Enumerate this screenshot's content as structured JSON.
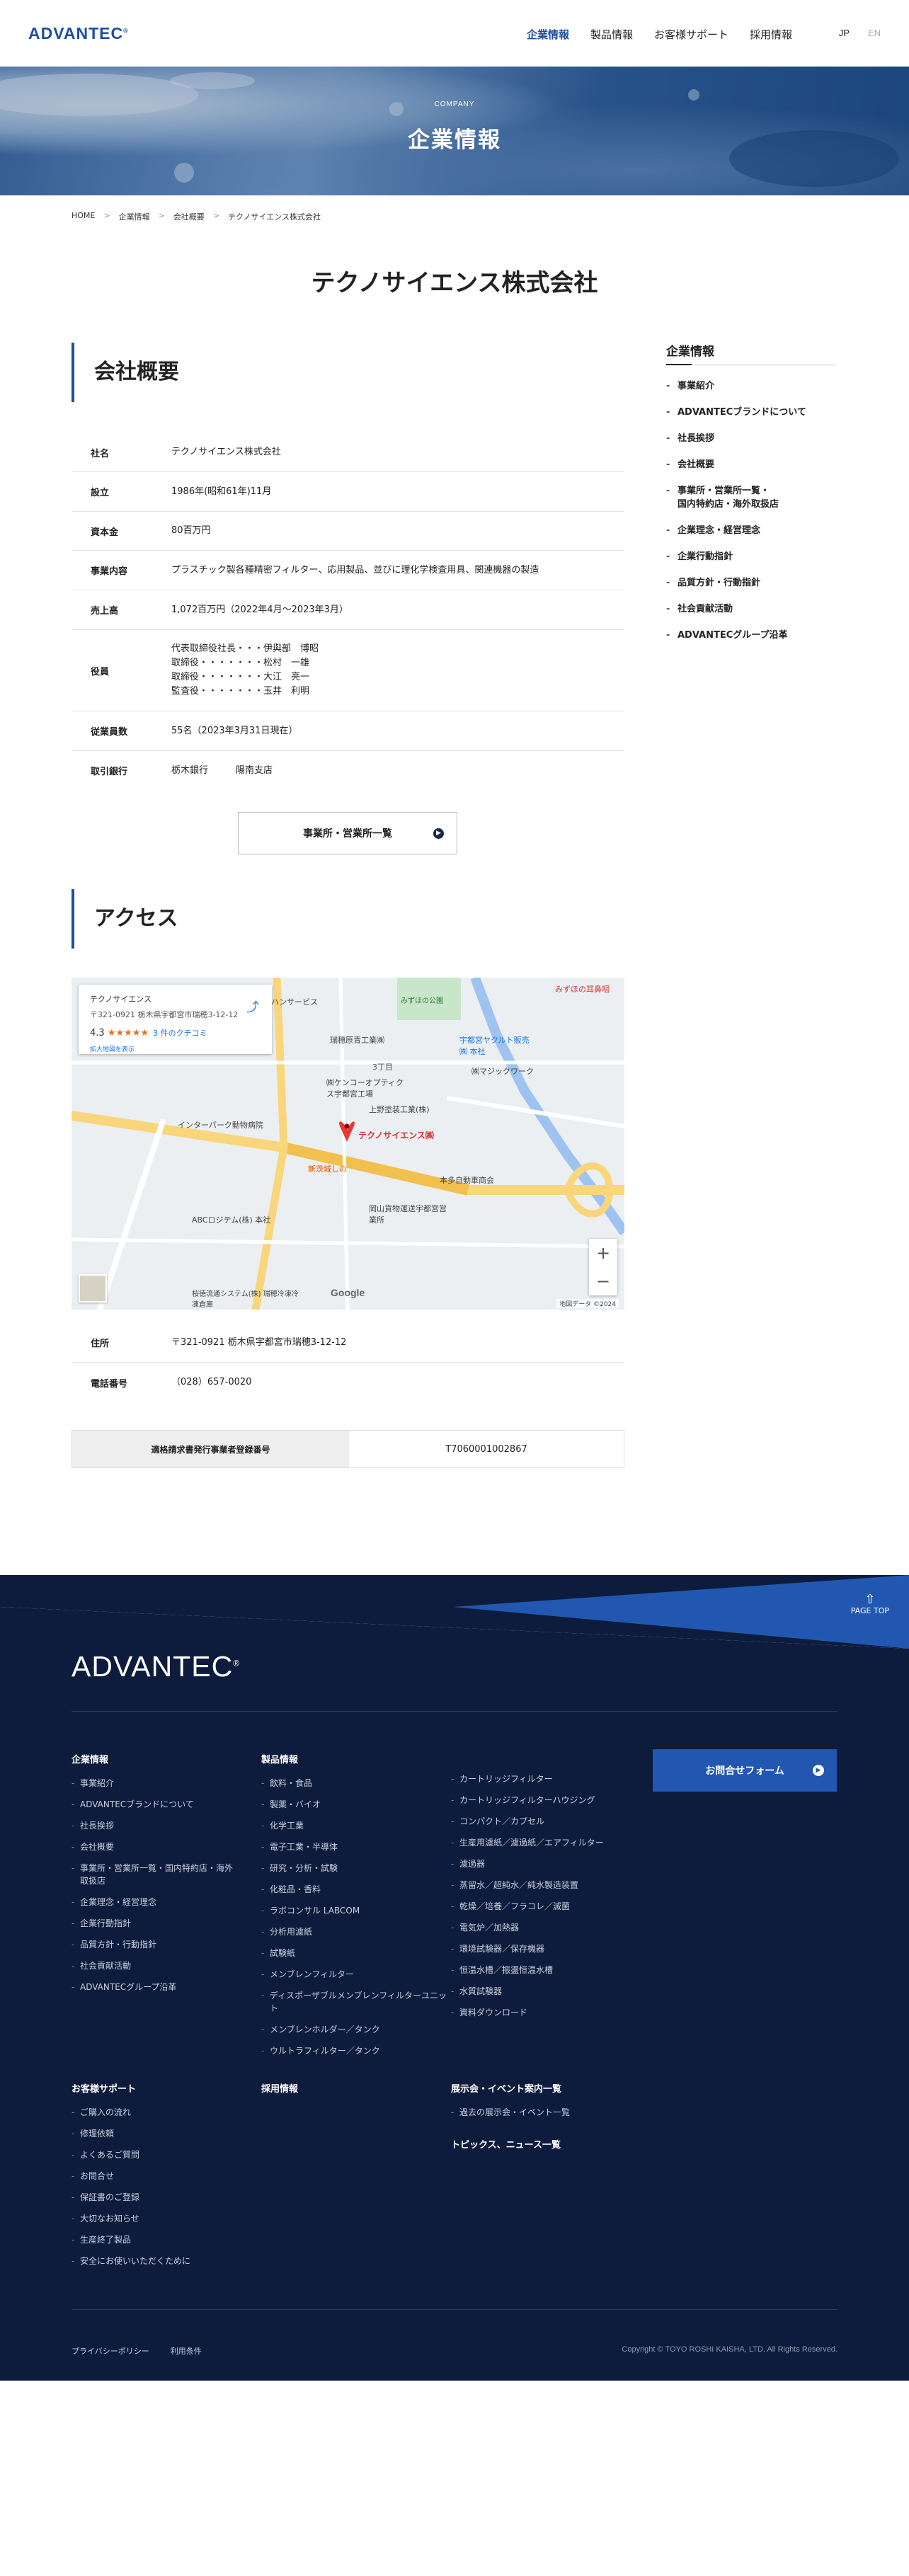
{
  "header": {
    "logo": "ADVANTEC",
    "logo_mark": "®",
    "nav": [
      "企業情報",
      "製品情報",
      "お客様サポート",
      "採用情報"
    ],
    "lang": [
      "JP",
      "EN"
    ]
  },
  "hero": {
    "en": "COMPANY",
    "title": "企業情報"
  },
  "breadcrumb": [
    "HOME",
    "企業情報",
    "会社概要",
    "テクノサイエンス株式会社"
  ],
  "breadcrumb_sep": ">",
  "page_title": "テクノサイエンス株式会社",
  "overview": {
    "heading": "会社概要",
    "rows": [
      {
        "k": "社名",
        "v": "テクノサイエンス株式会社"
      },
      {
        "k": "設立",
        "v": "1986年(昭和61年)11月"
      },
      {
        "k": "資本金",
        "v": "80百万円"
      },
      {
        "k": "事業内容",
        "v": "プラスチック製各種精密フィルター、応用製品、並びに理化学検査用具、関連機器の製造"
      },
      {
        "k": "売上高",
        "v": "1,072百万円（2022年4月〜2023年3月）"
      },
      {
        "k": "役員",
        "lines": [
          "代表取締役社長・・・伊與部　博昭",
          "取締役・・・・・・・松村　一雄",
          "取締役・・・・・・・大江　亮一",
          "監査役・・・・・・・玉井　利明"
        ]
      },
      {
        "k": "従業員数",
        "v": "55名（2023年3月31日現在）"
      },
      {
        "k": "取引銀行",
        "v": "栃木銀行　　　陽南支店"
      }
    ],
    "button": "事業所・営業所一覧"
  },
  "access": {
    "heading": "アクセス",
    "map": {
      "card_title": "テクノサイエンス",
      "card_addr": "〒321-0921 栃木県宇都宮市瑞穂3-12-12",
      "rating": "4.3",
      "stars": "★★★★★",
      "reviews": "3 件のクチコミ",
      "more": "拡大地図を表示",
      "pin_label": "テクノサイエンス㈱",
      "labels": [
        "ハンサービス",
        "みずほの耳鼻咽",
        "瑞穂原青工業㈱",
        "宇都宮ヤクルト販売㈱ 本社",
        "3丁目",
        "㈱ケンコーオプティクス宇都宮工場",
        "上野塗装工業(株)",
        "㈱マジックワーク",
        "インターパーク動物病院",
        "新茨城しの",
        "本多自動車商会",
        "岡山貨物運送宇都宮営業所",
        "ABCロジテム(株) 本社",
        "桜徳流通システム(株) 瑞穂冷凍冷凍倉庫",
        "みずほの公園"
      ],
      "google": "Google",
      "footer": "地図データ ©2024"
    },
    "rows": [
      {
        "k": "住所",
        "v": "〒321-0921 栃木県宇都宮市瑞穂3-12-12"
      },
      {
        "k": "電話番号",
        "v": "（028）657-0020"
      }
    ],
    "invoice_label": "適格請求書発行事業者登録番号",
    "invoice_no": "T7060001002867"
  },
  "sidebar": {
    "heading": "企業情報",
    "items": [
      "事業紹介",
      "ADVANTECブランドについて",
      "社長挨拶",
      "会社概要",
      "事業所・営業所一覧・\n国内特約店・海外取扱店",
      "企業理念・経営理念",
      "企業行動指針",
      "品質方針・行動指針",
      "社会貢献活動",
      "ADVANTECグループ沿革"
    ]
  },
  "footer": {
    "pagetop": "PAGE TOP",
    "logo": "ADVANTEC",
    "col1": {
      "h": "企業情報",
      "items": [
        "事業紹介",
        "ADVANTECブランドについて",
        "社長挨拶",
        "会社概要",
        "事業所・営業所一覧・国内特約店・海外取扱店",
        "企業理念・経営理念",
        "企業行動指針",
        "品質方針・行動指針",
        "社会貢献活動",
        "ADVANTECグループ沿革"
      ]
    },
    "col2": {
      "h": "製品情報",
      "items": [
        "飲料・食品",
        "製薬・バイオ",
        "化学工業",
        "電子工業・半導体",
        "研究・分析・試験",
        "化粧品・香料",
        "ラボコンサル LABCOM",
        "分析用濾紙",
        "試験紙",
        "メンブレンフィルター",
        "ディスポーザブルメンブレンフィルターユニット",
        "メンブレンホルダー／タンク",
        "ウルトラフィルター／タンク"
      ]
    },
    "col3": {
      "items": [
        "カートリッジフィルター",
        "カートリッジフィルターハウジング",
        "コンパクト／カプセル",
        "生産用濾紙／濾過紙／エアフィルター",
        "濾過器",
        "蒸留水／超純水／純水製造装置",
        "乾燥／培養／フラコレ／滅菌",
        "電気炉／加熱器",
        "環境試験器／保存機器",
        "恒温水槽／振盪恒温水槽",
        "水質試験器",
        "資料ダウンロード"
      ]
    },
    "contact": "お問合せフォーム",
    "col4": {
      "h": "お客様サポート",
      "items": [
        "ご購入の流れ",
        "修理依頼",
        "よくあるご質問",
        "お問合せ",
        "保証書のご登録",
        "大切なお知らせ",
        "生産終了製品",
        "安全にお使いいただくために"
      ]
    },
    "col5": {
      "h": "採用情報"
    },
    "col6": {
      "h": "展示会・イベント案内一覧",
      "items": [
        "過去の展示会・イベント一覧"
      ]
    },
    "col7": {
      "h": "トピックス、ニュース一覧"
    },
    "bottom_links": [
      "プライバシーポリシー",
      "利用条件"
    ],
    "copyright": "Copyright © TOYO ROSHI KAISHA, LTD. All Rights Reserved."
  }
}
